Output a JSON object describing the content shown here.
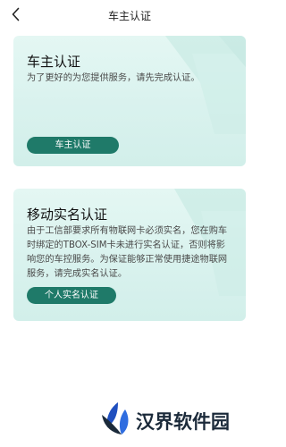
{
  "header": {
    "title": "车主认证",
    "back_icon": "chevron-left-icon"
  },
  "cards": [
    {
      "title": "车主认证",
      "description": "为了更好的为您提供服务，请先完成认证。",
      "button_label": "车主认证"
    },
    {
      "title": "移动实名认证",
      "description": "由于工信部要求所有物联网卡必须实名，您在购车时绑定的TBOX-SIM卡未进行实名认证，否则将影响您的车控服务。为保证能够正常使用捷途物联网服务，请完成实名认证。",
      "button_label": "个人实名认证"
    }
  ],
  "watermark": {
    "text": "汉界软件园",
    "icon": "tulip-logo-icon"
  },
  "colors": {
    "button": "#1f7a69",
    "card": "#d9f2ee",
    "watermark_text": "#1b2a3a",
    "watermark_icon": "#1f4fbf"
  }
}
